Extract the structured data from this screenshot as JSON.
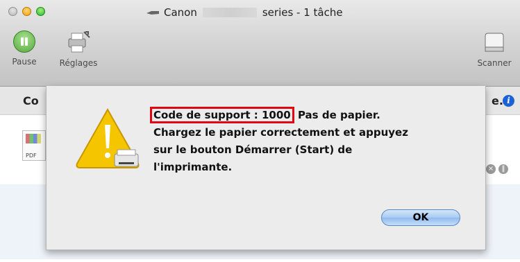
{
  "window": {
    "title_prefix": "Canon",
    "title_suffix": "series - 1 tâche"
  },
  "toolbar": {
    "pause_label": "Pause",
    "settings_label": "Réglages",
    "scanner_label": "Scanner"
  },
  "infobar": {
    "left_text": "Co",
    "right_text": "e."
  },
  "alert": {
    "code_text": "Code de support : 1000",
    "line1_rest": "Pas de papier.",
    "line2": "Chargez le papier correctement et appuyez",
    "line3": "sur le bouton Démarrer (Start) de",
    "line4": "l'imprimante.",
    "ok_label": "OK"
  },
  "job": {
    "file_type": "PDF"
  },
  "colors": {
    "highlight_box": "#e20613",
    "warning_yellow": "#f5c500",
    "info_blue": "#1a62d6"
  },
  "icons": {
    "warning": "warning-triangle-icon",
    "info": "info-icon"
  }
}
